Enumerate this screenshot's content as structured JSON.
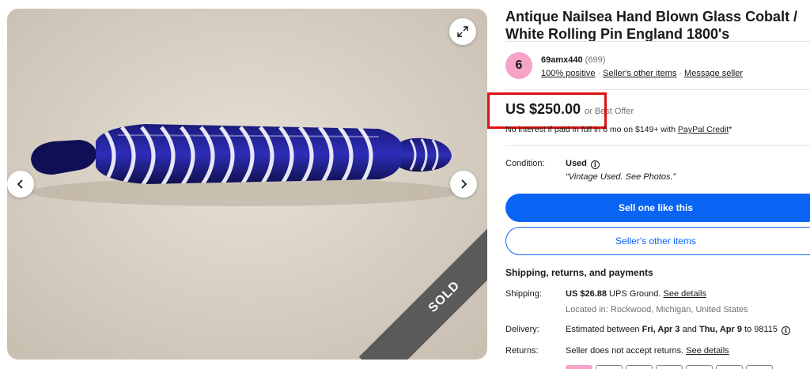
{
  "listing": {
    "title": "Antique Nailsea Hand Blown Glass Cobalt / White Rolling Pin England 1800's",
    "sold_badge": "SOLD"
  },
  "seller": {
    "avatar_letter": "6",
    "name": "69amx440",
    "feedback_count": "(699)",
    "positive": "100% positive",
    "other_items": "Seller's other items",
    "message": "Message seller"
  },
  "pricing": {
    "price": "US $250.00",
    "best_offer": "or Best Offer",
    "credit_text": "No interest if paid in full in 6 mo on $149+ with ",
    "credit_link": "PayPal Credit",
    "credit_suffix": "*"
  },
  "condition": {
    "label": "Condition:",
    "value": "Used",
    "note": "“Vintage Used. See Photos.”"
  },
  "actions": {
    "sell_one": "Sell one like this",
    "seller_items": "Seller's other items"
  },
  "shipping": {
    "heading": "Shipping, returns, and payments",
    "ship_label": "Shipping:",
    "ship_cost": "US $26.88",
    "ship_method": " UPS Ground. ",
    "ship_details": "See details",
    "location": "Located in: Rockwood, Michigan, United States",
    "delivery_label": "Delivery:",
    "delivery_prefix": "Estimated between ",
    "delivery_start": "Fri, Apr 3",
    "delivery_and": " and ",
    "delivery_end": "Thu, Apr 9",
    "delivery_zip": " to 98115",
    "returns_label": "Returns:",
    "returns_text": "Seller does not accept returns. ",
    "returns_details": "See details"
  },
  "icons": {
    "expand": "expand-icon",
    "prev": "chevron-left-icon",
    "next": "chevron-right-icon",
    "info": "info-icon"
  },
  "colors": {
    "primary": "#0964f4",
    "highlight": "#e01010",
    "avatar": "#f5a3c7"
  }
}
